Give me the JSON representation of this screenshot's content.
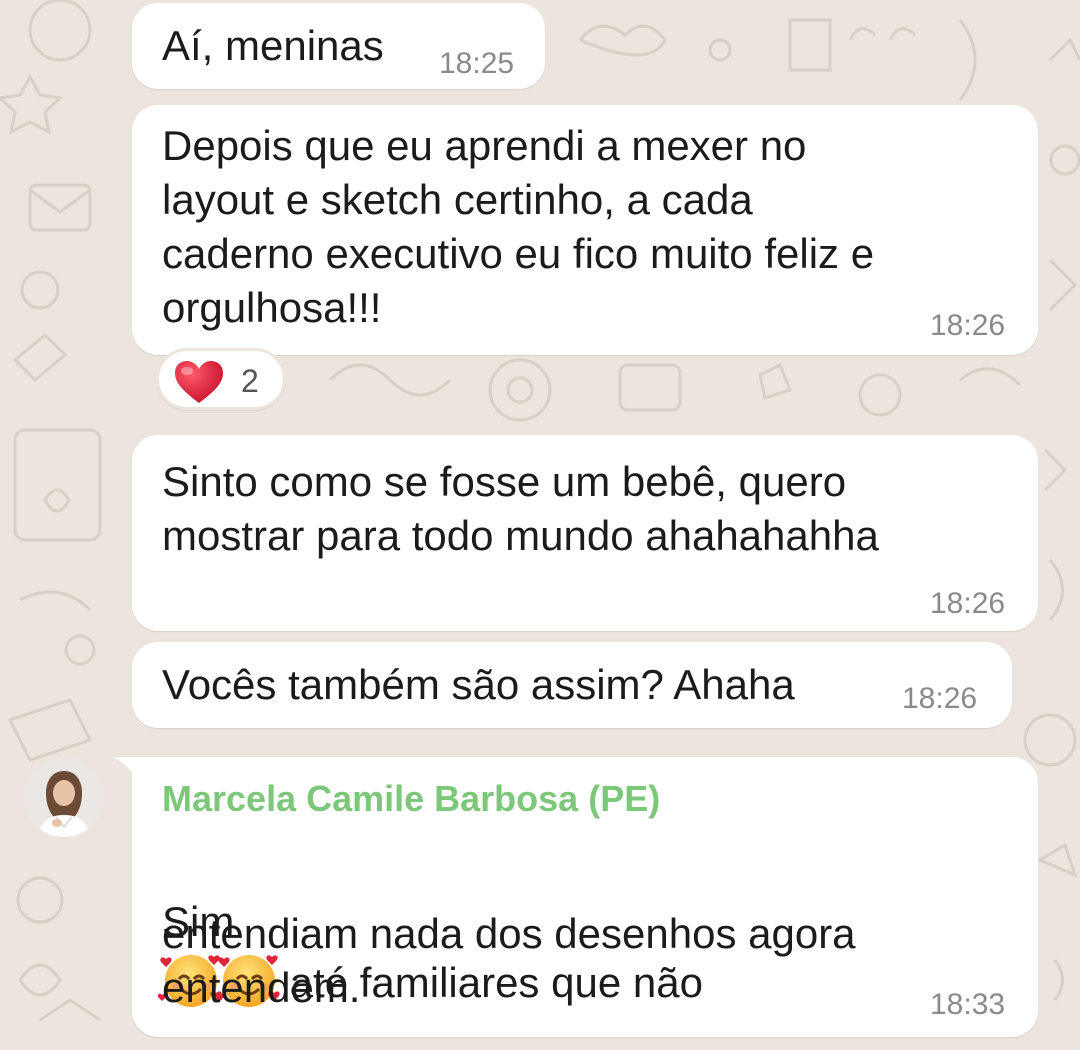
{
  "theme": {
    "background": "#ece5dd",
    "bubble_color": "#ffffff",
    "sender_name_color": "#7dc77a",
    "timestamp_color": "#8a8a8a"
  },
  "messages": [
    {
      "text": "Aí, meninas",
      "time": "18:25"
    },
    {
      "text": "Depois que eu aprendi a mexer no\nlayout e sketch certinho, a cada\ncaderno executivo eu fico muito feliz e\norgulhosa!!!",
      "time": "18:26",
      "reaction": {
        "icon": "red-heart",
        "count": "2"
      }
    },
    {
      "text": "Sinto como se fosse um bebê, quero\nmostrar para todo mundo ahahahahha",
      "time": "18:26"
    },
    {
      "text": "Vocês também são assim? Ahaha",
      "time": "18:26"
    },
    {
      "sender": "Marcela Camile Barbosa (PE)",
      "avatar": "user-avatar",
      "text_prefix": "Sim",
      "emojis": [
        "smiling-face-with-hearts",
        "smiling-face-with-hearts"
      ],
      "text_suffix": " até familiares que não",
      "text_rest": "entendiam nada dos desenhos agora\nentendem.",
      "time": "18:33"
    }
  ]
}
